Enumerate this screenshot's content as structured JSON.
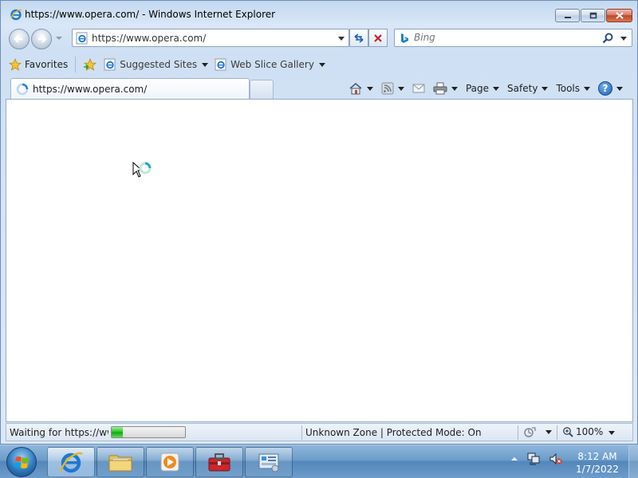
{
  "window": {
    "title": "https://www.opera.com/ - Windows Internet Explorer"
  },
  "address_bar": {
    "url": "https://www.opera.com/"
  },
  "search_box": {
    "placeholder": "Bing"
  },
  "favorites_bar": {
    "favorites_label": "Favorites",
    "suggested_sites_label": "Suggested Sites",
    "web_slice_gallery_label": "Web Slice Gallery"
  },
  "tabs": [
    {
      "label": "https://www.opera.com/",
      "active": true
    }
  ],
  "command_bar": {
    "page_label": "Page",
    "safety_label": "Safety",
    "tools_label": "Tools",
    "help_glyph": "?"
  },
  "status_bar": {
    "status_text": "Waiting for https://www.opera.com/...",
    "progress_fraction": 0.15,
    "zone_text": "Unknown Zone | Protected Mode: On",
    "zoom": "100%"
  },
  "taskbar": {
    "time": "8:12 AM",
    "date": "1/7/2022"
  },
  "icons": {
    "ie": "internet-explorer-icon",
    "back": "back-arrow-icon",
    "forward": "forward-arrow-icon",
    "refresh": "refresh-icon",
    "stop": "stop-icon",
    "search": "magnifier-icon",
    "home": "home-icon",
    "feeds": "rss-feed-icon",
    "mail": "mail-icon",
    "print": "printer-icon",
    "help": "help-icon"
  },
  "colors": {
    "progress_green": "#20c01c",
    "stop_red": "#c0272d",
    "help_blue": "#1d5fb6",
    "bing_blue": "#1b82c8"
  }
}
